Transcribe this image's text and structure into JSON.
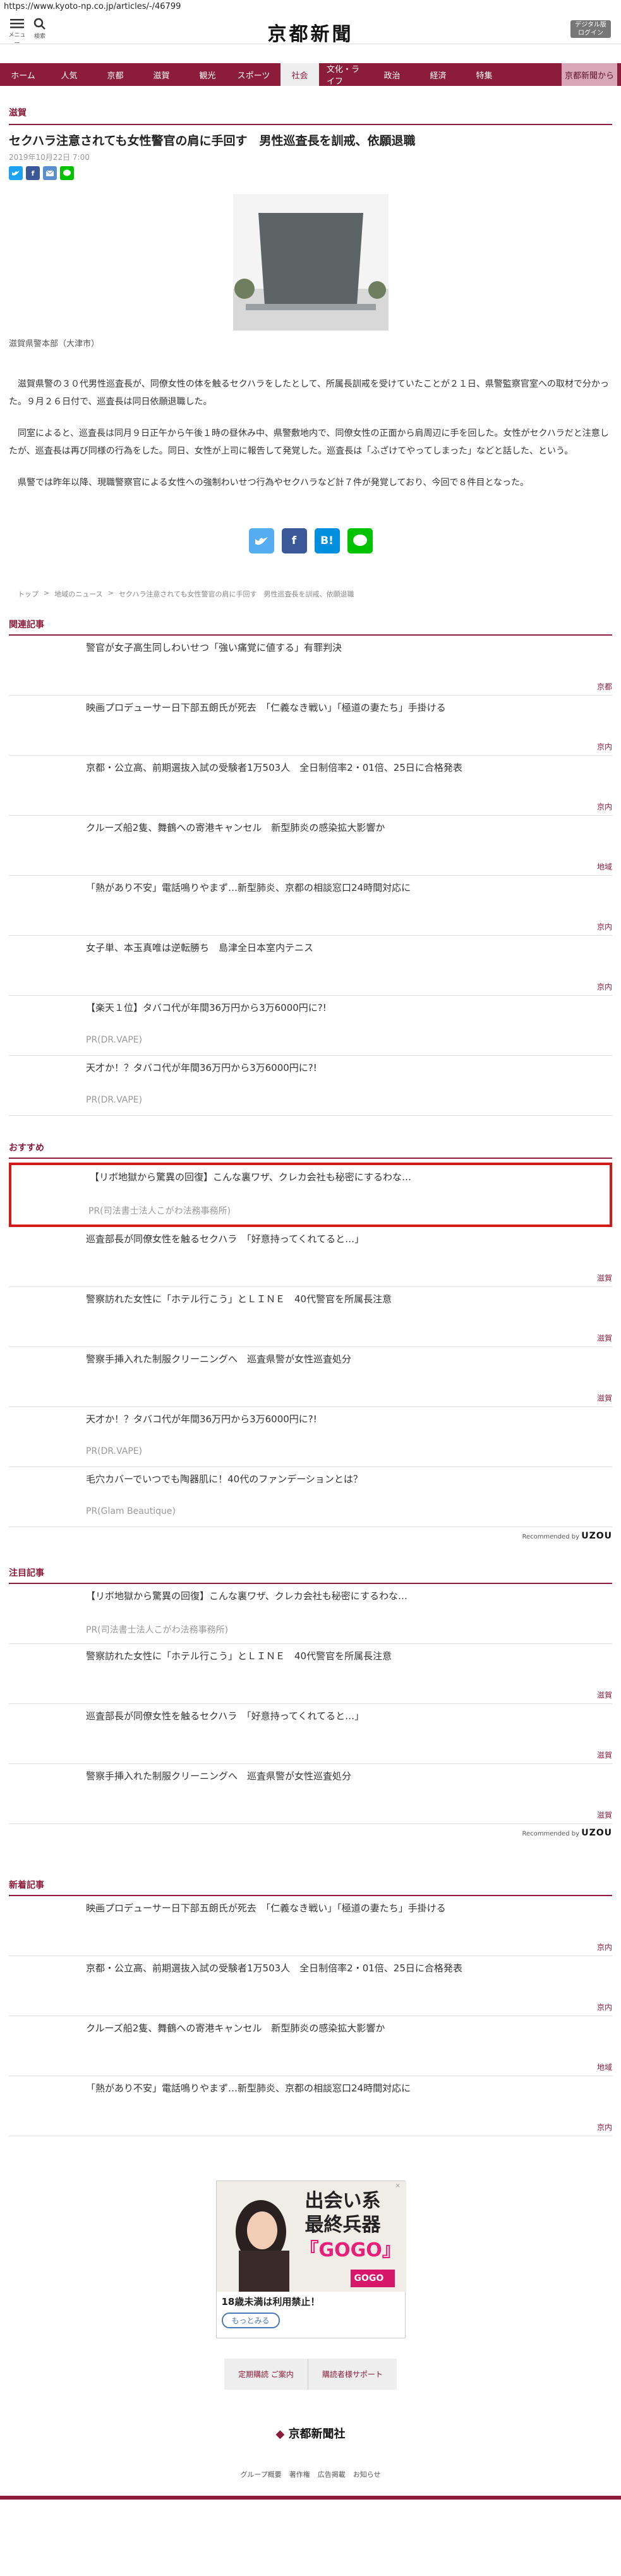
{
  "url": "https://www.kyoto-np.co.jp/articles/-/46799",
  "header": {
    "menu_label": "メニュー",
    "search_label": "検索",
    "logo": "京都新聞",
    "digital_label": "デジタル版",
    "login_label": "ログイン"
  },
  "nav": [
    "ホーム",
    "人気",
    "京都",
    "滋賀",
    "観光",
    "スポーツ",
    "社会",
    "文化・ライフ",
    "政治",
    "経済",
    "特集",
    "京都新聞から"
  ],
  "nav_active": "社会",
  "article": {
    "category": "滋賀",
    "title": "セクハラ注意されても女性警官の肩に手回す　男性巡査長を訓戒、依願退職",
    "date": "2019年10月22日 7:00",
    "caption": "滋賀県警本部（大津市）",
    "paragraphs": [
      "滋賀県警の３０代男性巡査長が、同僚女性の体を触るセクハラをしたとして、所属長訓戒を受けていたことが２１日、県警監察官室への取材で分かった。９月２６日付で、巡査長は同日依願退職した。",
      "同室によると、巡査長は同月９日正午から午後１時の昼休み中、県警敷地内で、同僚女性の正面から肩周辺に手を回した。女性がセクハラだと注意したが、巡査長は再び同様の行為をした。同日、女性が上司に報告して発覚した。巡査長は「ふざけてやってしまった」などと話した、という。",
      "県警では昨年以降、現職警察官による女性への強制わいせつ行為やセクハラなど計７件が発覚しており、今回で８件目となった。"
    ],
    "breadcrumb": [
      "トップ",
      "地域のニュース",
      "セクハラ注意されても女性警官の肩に手回す　男性巡査長を訓戒、依願退職"
    ]
  },
  "share_labels": {
    "twitter": "t",
    "facebook": "f",
    "hatena": "B!",
    "line": "L"
  },
  "related": {
    "heading": "関連記事",
    "items": [
      {
        "title": "警官が女子高生同しわいせつ「強い痛覚に値する」有罪判決",
        "cat": "京都",
        "src": ""
      },
      {
        "title": "映画プロデューサー日下部五朗氏が死去　「仁義なき戦い」「極道の妻たち」手掛ける",
        "cat": "京内",
        "src": ""
      },
      {
        "title": "京都・公立高、前期選抜入試の受験者1万503人　全日制倍率2・01倍、25日に合格発表",
        "cat": "京内",
        "src": ""
      },
      {
        "title": "クルーズ船2隻、舞鶴への寄港キャンセル　新型肺炎の感染拡大影響か",
        "cat": "地域",
        "src": ""
      },
      {
        "title": "「熱があり不安」電話鳴りやまず…新型肺炎、京都の相談窓口24時間対応に",
        "cat": "京内",
        "src": ""
      },
      {
        "title": "女子単、本玉真唯は逆転勝ち　島津全日本室内テニス",
        "cat": "京内",
        "src": ""
      },
      {
        "title": "【楽天１位】タバコ代が年間36万円から3万6000円に?!",
        "cat": "",
        "src": "PR(DR.VAPE)"
      },
      {
        "title": "天才か！？タバコ代が年間36万円から3万6000円に?!",
        "cat": "",
        "src": "PR(DR.VAPE)"
      }
    ]
  },
  "recommend": {
    "heading": "おすすめ",
    "items": [
      {
        "title": "【リボ地獄から驚異の回復】こんな裏ワザ、クレカ会社も秘密にするわな…",
        "cat": "",
        "src": "PR(司法書士法人こがわ法務事務所)"
      },
      {
        "title": "巡査部長が同僚女性を触るセクハラ　「好意持ってくれてると…」",
        "cat": "滋賀",
        "src": ""
      },
      {
        "title": "警察訪れた女性に「ホテル行こう」とＬＩＮＥ　40代警官を所属長注意",
        "cat": "滋賀",
        "src": ""
      },
      {
        "title": "警察手挿入れた制服クリーニングへ　巡査県警が女性巡査処分",
        "cat": "滋賀",
        "src": ""
      },
      {
        "title": "天才か！？タバコ代が年間36万円から3万6000円に?!",
        "cat": "",
        "src": "PR(DR.VAPE)"
      },
      {
        "title": "毛穴カバーでいつでも陶器肌に！40代のファンデーションとは？",
        "cat": "",
        "src": "PR(Glam Beautique)"
      }
    ]
  },
  "recommended_by": "Recommended by",
  "uzou": "UZOU",
  "attention": {
    "heading": "注目記事",
    "items": [
      {
        "title": "【リボ地獄から驚異の回復】こんな裏ワザ、クレカ会社も秘密にするわな…",
        "cat": "",
        "src": "PR(司法書士法人こがわ法務事務所)"
      },
      {
        "title": "警察訪れた女性に「ホテル行こう」とＬＩＮＥ　40代警官を所属長注意",
        "cat": "滋賀",
        "src": ""
      },
      {
        "title": "巡査部長が同僚女性を触るセクハラ　「好意持ってくれてると…」",
        "cat": "滋賀",
        "src": ""
      },
      {
        "title": "警察手挿入れた制服クリーニングへ　巡査県警が女性巡査処分",
        "cat": "滋賀",
        "src": ""
      }
    ]
  },
  "latest": {
    "heading": "新着記事",
    "items": [
      {
        "title": "映画プロデューサー日下部五朗氏が死去　「仁義なき戦い」「極道の妻たち」手掛ける",
        "cat": "京内",
        "src": ""
      },
      {
        "title": "京都・公立高、前期選抜入試の受験者1万503人　全日制倍率2・01倍、25日に合格発表",
        "cat": "京内",
        "src": ""
      },
      {
        "title": "クルーズ船2隻、舞鶴への寄港キャンセル　新型肺炎の感染拡大影響か",
        "cat": "地域",
        "src": ""
      },
      {
        "title": "「熱があり不安」電話鳴りやまず…新型肺炎、京都の相談窓口24時間対応に",
        "cat": "京内",
        "src": ""
      }
    ]
  },
  "ad": {
    "headline1": "出会い系",
    "headline2": "最終兵器",
    "headline3": "『GOGO』",
    "warning": "18歳未満は利用禁止！",
    "cta": "もっとみる",
    "logo": "GOGO"
  },
  "footer_buttons": [
    "定期購読 ご案内",
    "購読者様サポート"
  ],
  "footer_logo": "京都新聞社",
  "footer_links": [
    "グループ概要",
    "著作権",
    "広告掲載",
    "お知らせ"
  ]
}
